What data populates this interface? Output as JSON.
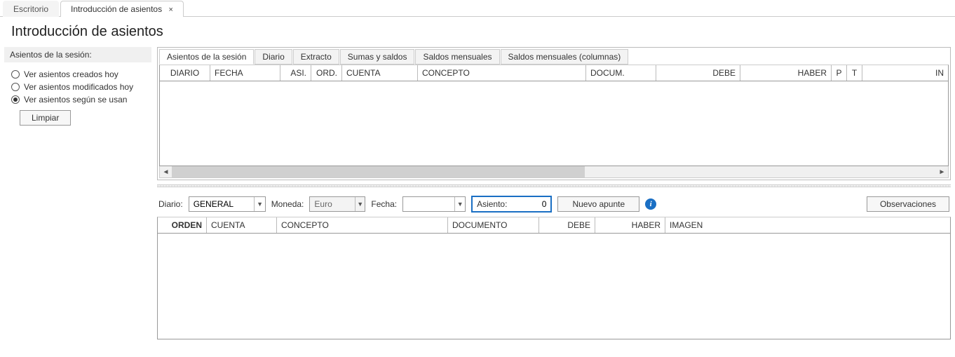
{
  "topTabs": {
    "escritorio": "Escritorio",
    "intro": "Introducción de asientos"
  },
  "title": "Introducción de asientos",
  "sidebar": {
    "header": "Asientos de la sesión:",
    "opt1": "Ver asientos creados hoy",
    "opt2": "Ver asientos modificados hoy",
    "opt3": "Ver asientos según se usan",
    "limpiar": "Limpiar"
  },
  "subTabs": {
    "t0": "Asientos de la sesión",
    "t1": "Diario",
    "t2": "Extracto",
    "t3": "Sumas y saldos",
    "t4": "Saldos mensuales",
    "t5": "Saldos mensuales (columnas)"
  },
  "grid1Cols": {
    "diario": "DIARIO",
    "fecha": "FECHA",
    "asi": "ASI.",
    "ord": "ORD.",
    "cuenta": "CUENTA",
    "concepto": "CONCEPTO",
    "docum": "DOCUM.",
    "debe": "DEBE",
    "haber": "HABER",
    "p": "P",
    "t": "T",
    "in": "IN"
  },
  "toolbar": {
    "diarioLabel": "Diario:",
    "diarioValue": "GENERAL",
    "monedaLabel": "Moneda:",
    "monedaValue": "Euro",
    "fechaLabel": "Fecha:",
    "fechaValue": "",
    "asientoLabel": "Asiento:",
    "asientoValue": "0",
    "nuevoApunte": "Nuevo apunte",
    "observaciones": "Observaciones"
  },
  "grid2Cols": {
    "orden": "ORDEN",
    "cuenta": "CUENTA",
    "concepto": "CONCEPTO",
    "documento": "DOCUMENTO",
    "debe": "DEBE",
    "haber": "HABER",
    "imagen": "IMAGEN"
  }
}
